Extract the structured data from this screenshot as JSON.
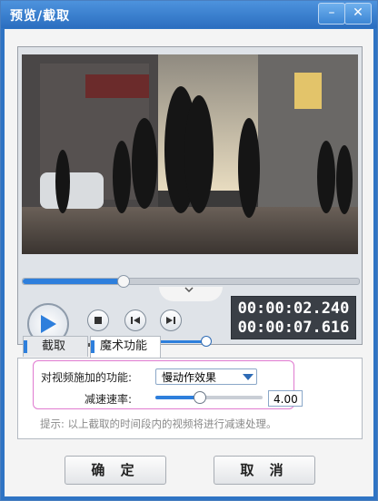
{
  "window": {
    "title": "预览/截取",
    "minimize_glyph": "–",
    "close_glyph": "✕"
  },
  "player": {
    "seek_progress": 0.29,
    "volume_level": 0.98,
    "current_time": "00:00:02.240",
    "total_time": "00:00:07.616"
  },
  "tabs": [
    {
      "label": "截取",
      "active": false
    },
    {
      "label": "魔术功能",
      "active": true
    }
  ],
  "magic": {
    "function_label": "对视频施加的功能:",
    "function_value": "慢动作效果",
    "speed_label": "减速速率:",
    "speed_value": "4.00",
    "speed_slider_level": 0.46,
    "hint": "提示: 以上截取的时间段内的视频将进行减速处理。"
  },
  "buttons": {
    "ok": "确 定",
    "cancel": "取 消"
  },
  "colors": {
    "accent": "#2e7fdc",
    "title_bar": "#2b6ec0",
    "highlight_border": "#e07ad0"
  }
}
